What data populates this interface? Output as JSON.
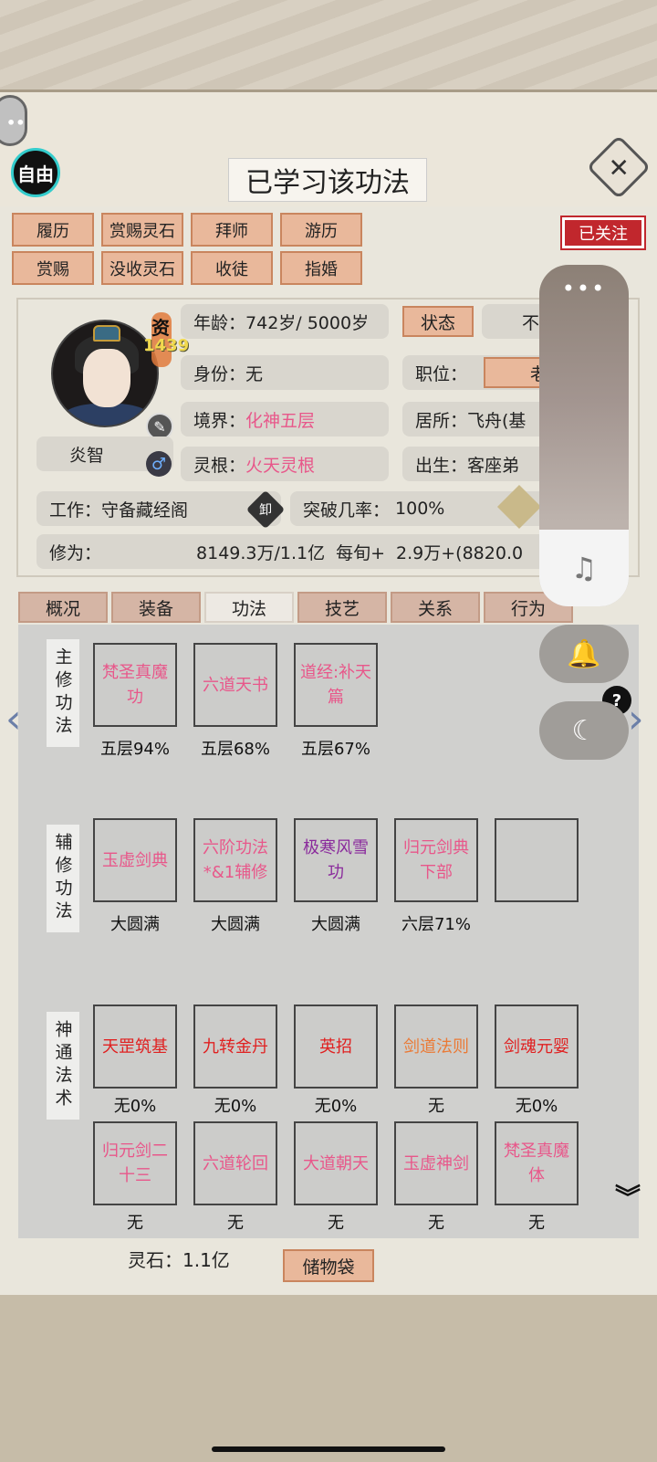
{
  "header": {
    "title_partial": "……",
    "toast": "已学习该功法",
    "free_label": "自由",
    "close_icon": "close-icon",
    "follow_label": "已关注"
  },
  "actions": [
    {
      "label": "履历"
    },
    {
      "label": "赏赐灵石"
    },
    {
      "label": "拜师"
    },
    {
      "label": "游历"
    },
    {
      "label": "赏赐"
    },
    {
      "label": "没收灵石"
    },
    {
      "label": "收徒"
    },
    {
      "label": "指婚"
    }
  ],
  "character": {
    "name": "炎智",
    "zi_label": "资",
    "zi_value": "1439",
    "age_label": "年龄：",
    "age_value": "742岁/ 5000岁",
    "status_label": "状态",
    "status_value": "不",
    "identity_label": "身份：",
    "identity_value": "无",
    "position_label": "职位：",
    "position_value": "老",
    "realm_label": "境界：",
    "realm_value": "化神五层",
    "residence_label": "居所：",
    "residence_value": "飞舟(基",
    "root_label": "灵根：",
    "root_value": "火天灵根",
    "birth_label": "出生：",
    "birth_value": "客座弟",
    "job_label": "工作：",
    "job_value": "守备藏经阁",
    "unload_label": "卸",
    "breakthrough_label": "突破几率：",
    "breakthrough_value": "100%",
    "cultivation_label": "修为：",
    "cultivation_value": "8149.3万/1.1亿",
    "per_turn_label": "每旬+",
    "per_turn_value": "2.9万+(8820.0"
  },
  "tabs": [
    {
      "label": "概况"
    },
    {
      "label": "装备"
    },
    {
      "label": "功法",
      "active": true
    },
    {
      "label": "技艺"
    },
    {
      "label": "关系"
    },
    {
      "label": "行为"
    }
  ],
  "sections": {
    "main": {
      "label": "主修功法",
      "skills": [
        {
          "name": "梵圣真魔功",
          "level": "五层94%",
          "color": "#e8578a"
        },
        {
          "name": "六道天书",
          "level": "五层68%",
          "color": "#e8578a"
        },
        {
          "name": "道经:补天篇",
          "level": "五层67%",
          "color": "#e8578a"
        }
      ]
    },
    "aux": {
      "label": "辅修功法",
      "skills": [
        {
          "name": "玉虚剑典",
          "level": "大圆满",
          "color": "#e8578a"
        },
        {
          "name": "六阶功法*&1辅修",
          "level": "大圆满",
          "color": "#e8578a"
        },
        {
          "name": "极寒风雪功",
          "level": "大圆满",
          "color": "#8a2a9c"
        },
        {
          "name": "归元剑典下部",
          "level": "六层71%",
          "color": "#e8578a"
        },
        {
          "name": "",
          "level": "",
          "color": ""
        }
      ]
    },
    "magic": {
      "label": "神通法术",
      "skills": [
        {
          "name": "天罡筑基",
          "level": "无0%",
          "color": "#e02020"
        },
        {
          "name": "九转金丹",
          "level": "无0%",
          "color": "#e02020"
        },
        {
          "name": "英招",
          "level": "无0%",
          "color": "#e02020"
        },
        {
          "name": "剑道法则",
          "level": "无",
          "color": "#ea7a36"
        },
        {
          "name": "剑魂元婴",
          "level": "无0%",
          "color": "#e02020"
        },
        {
          "name": "归元剑二十三",
          "level": "无",
          "color": "#e8578a"
        },
        {
          "name": "六道轮回",
          "level": "无",
          "color": "#e8578a"
        },
        {
          "name": "大道朝天",
          "level": "无",
          "color": "#e8578a"
        },
        {
          "name": "玉虚神剑",
          "level": "无",
          "color": "#e8578a"
        },
        {
          "name": "梵圣真魔体",
          "level": "无",
          "color": "#e8578a"
        }
      ]
    }
  },
  "footer": {
    "stones": "灵石：1.1亿",
    "bag_label": "储物袋"
  },
  "overlay": {
    "dots": "•••",
    "music_icon": "music-note-icon",
    "bell_icon": "bell-icon",
    "moon_icon": "moon-icon"
  },
  "glyphs": {
    "close": "✕",
    "left_arrow": "‹",
    "right_arrow": "›",
    "help": "?",
    "more": "︾",
    "music": "♫",
    "bell": "🔔",
    "moon": "☾",
    "pen": "✎",
    "male": "♂",
    "chat": "••"
  }
}
